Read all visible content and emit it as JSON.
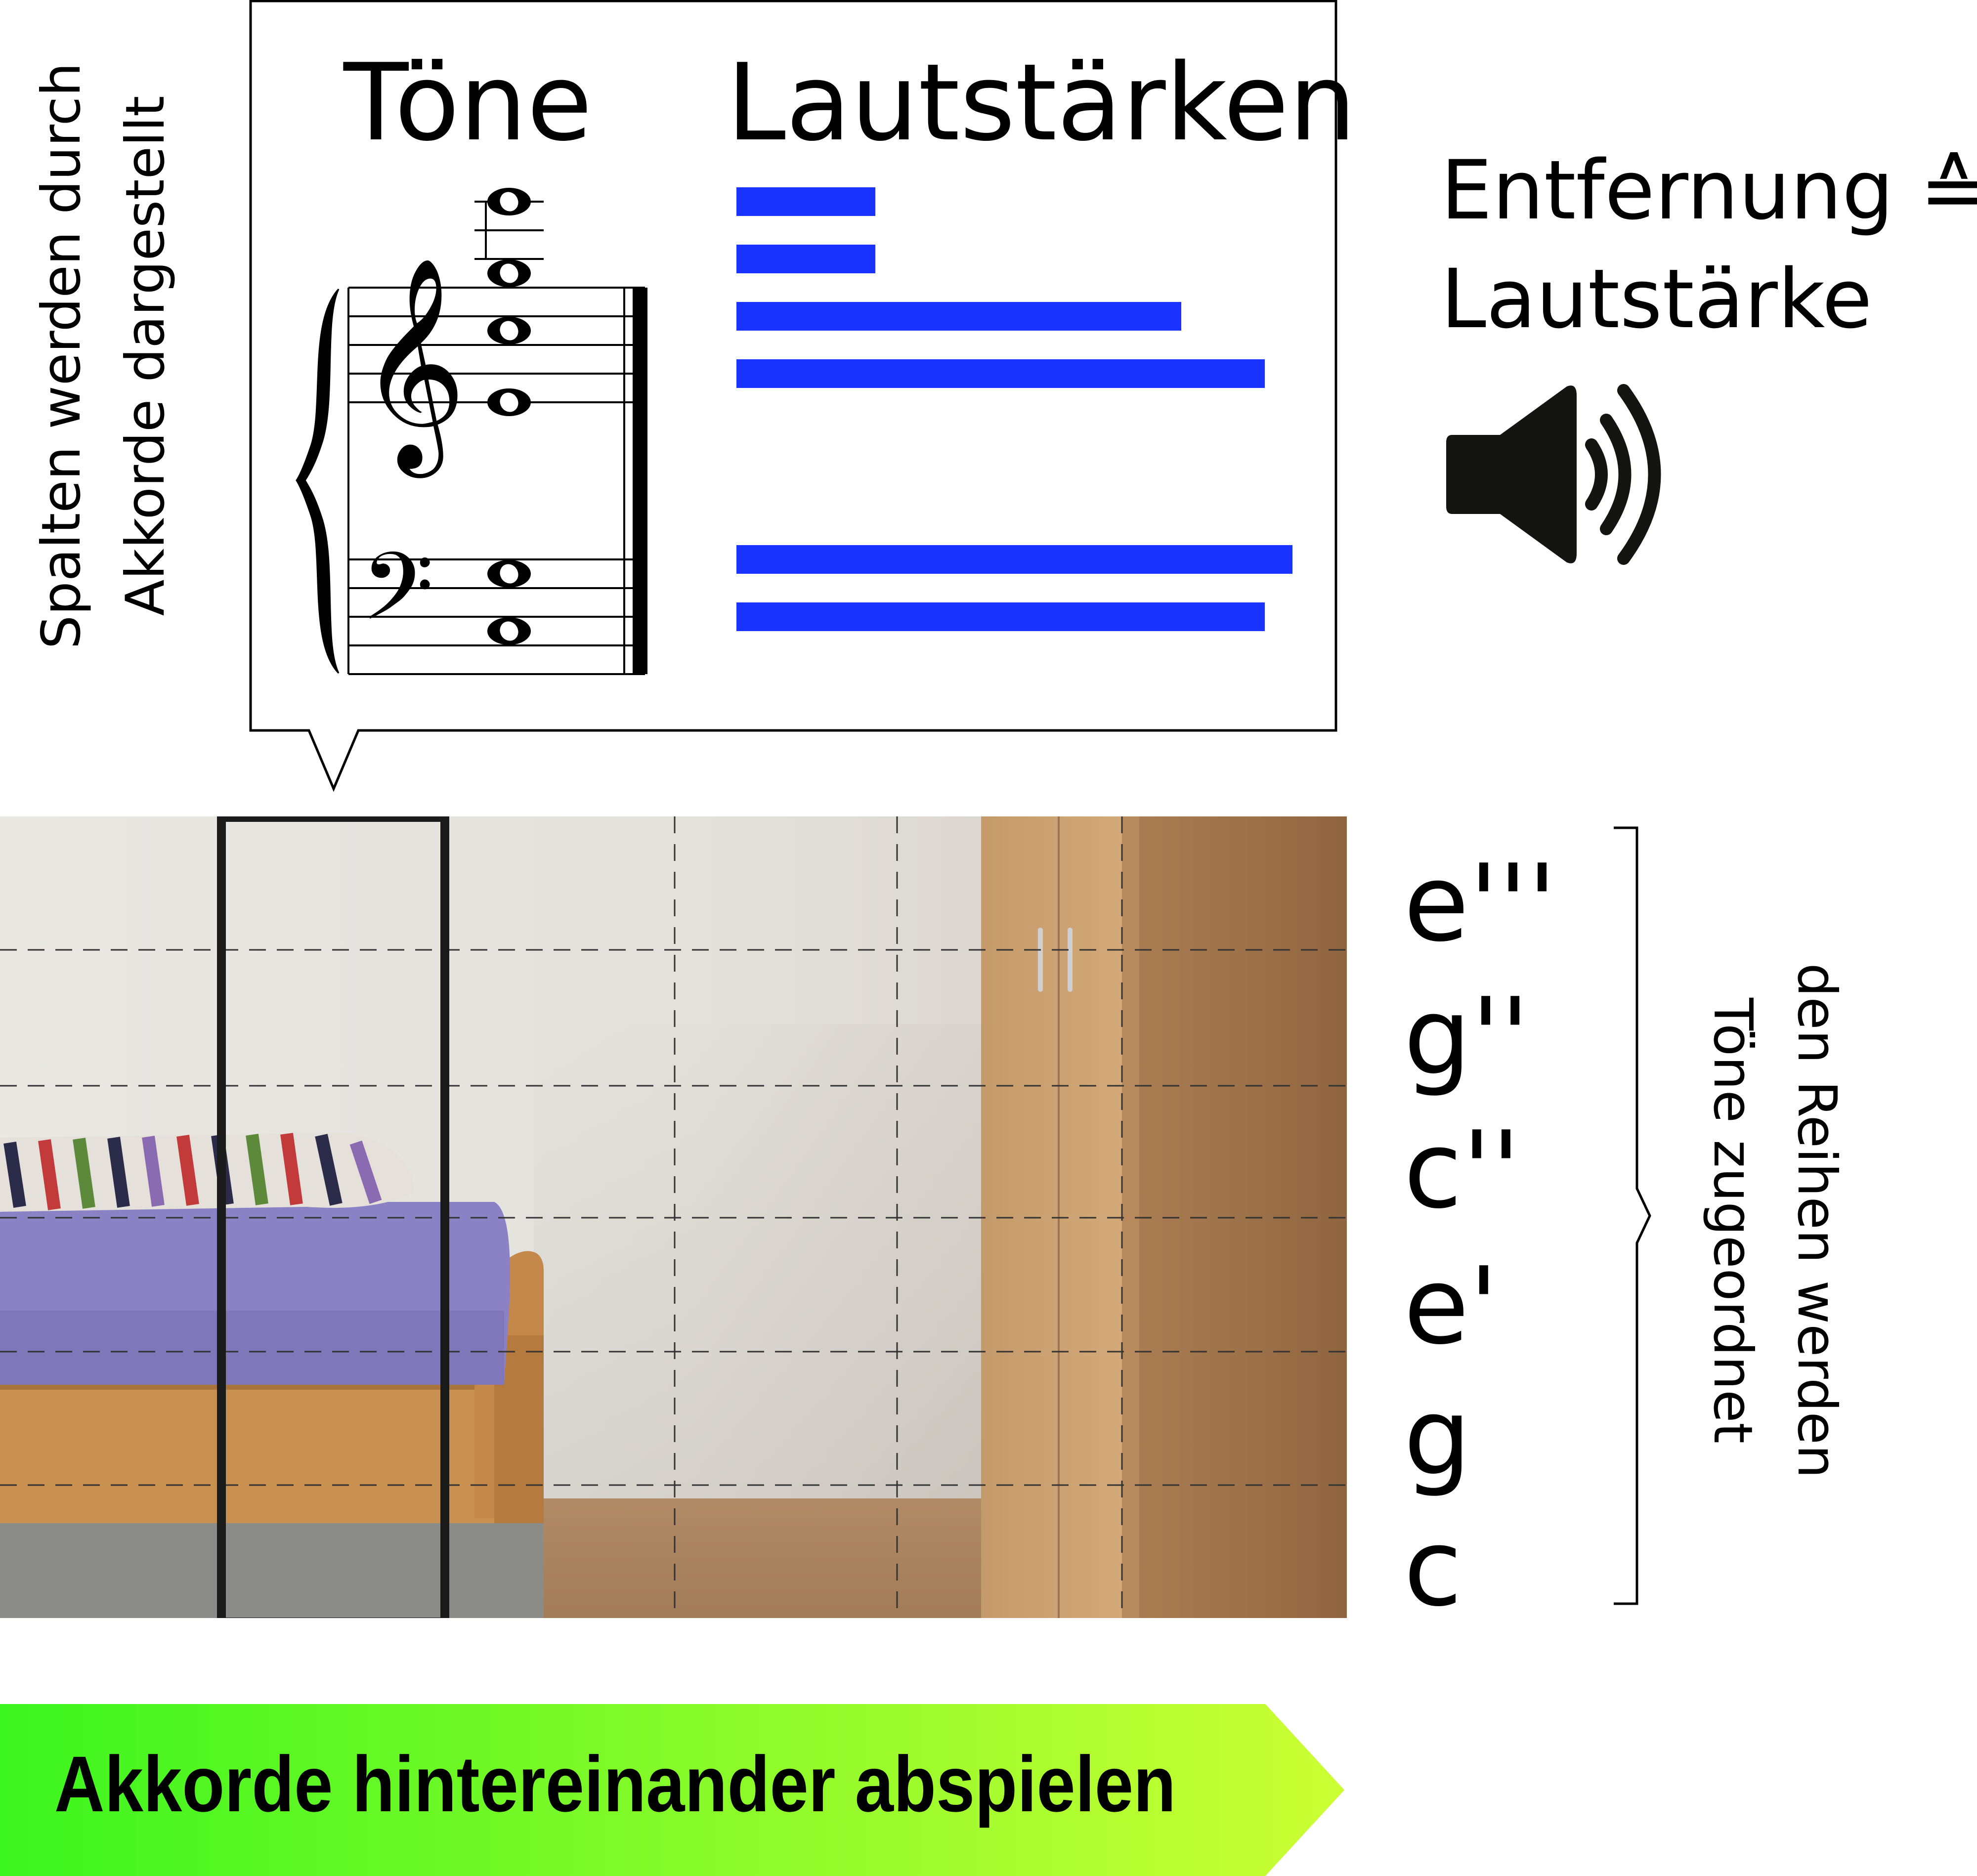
{
  "left_caption": {
    "line1": "Spalten werden durch",
    "line2": "Akkorde dargestellt"
  },
  "callout": {
    "tones_heading": "Töne",
    "volumes_heading": "Lautstärken"
  },
  "volume_bars": {
    "color": "#1a33ff",
    "values": [
      0.25,
      0.25,
      0.8,
      0.95,
      1.0,
      0.95
    ]
  },
  "distance_text": {
    "line1": "Entfernung ≙",
    "line2": "Lautstärke"
  },
  "speaker": {
    "icon": "speaker-icon"
  },
  "tones": [
    "e'''",
    "g''",
    "c''",
    "e'",
    "g",
    "c"
  ],
  "right_caption": {
    "line1": "den Reihen werden",
    "line2": "Töne zugeordnet"
  },
  "play": {
    "label": "Akkorde hintereinander abspielen",
    "color_start": "#3cf51f",
    "color_end": "#ccff33"
  }
}
